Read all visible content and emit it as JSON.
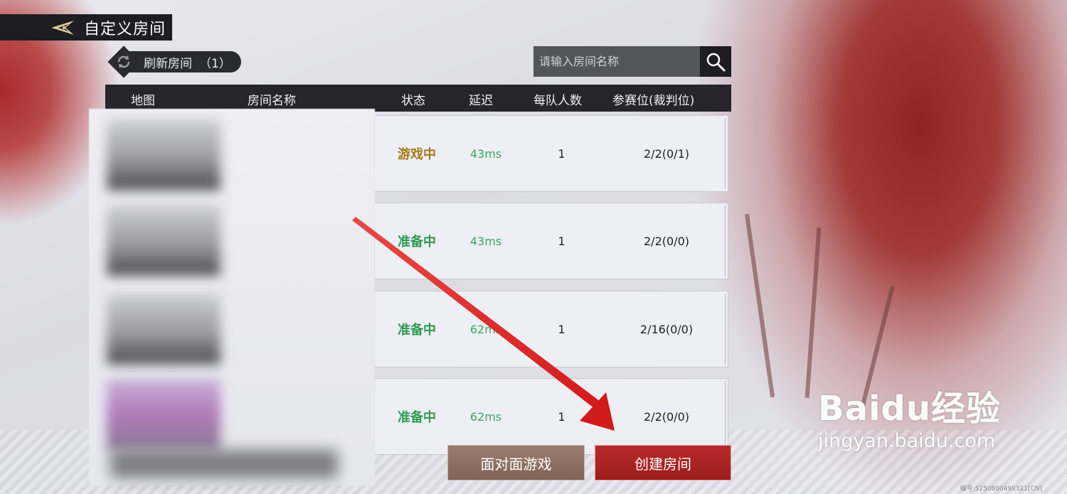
{
  "header": {
    "title": "自定义房间"
  },
  "refresh": {
    "label": "刷新房间",
    "count": "（1）"
  },
  "search": {
    "placeholder": "请输入房间名称"
  },
  "columns": {
    "map": "地图",
    "room_name": "房间名称",
    "status": "状态",
    "latency": "延迟",
    "per_team": "每队人数",
    "slots": "参赛位(裁判位)"
  },
  "rooms": [
    {
      "status": "游戏中",
      "status_color": "#a07b17",
      "latency": "43ms",
      "per_team": "1",
      "slots": "2/2(0/1)"
    },
    {
      "status": "准备中",
      "status_color": "#2e9a4f",
      "latency": "43ms",
      "per_team": "1",
      "slots": "2/2(0/0)"
    },
    {
      "status": "准备中",
      "status_color": "#2e9a4f",
      "latency": "62ms",
      "per_team": "1",
      "slots": "2/16(0/0)"
    },
    {
      "status": "准备中",
      "status_color": "#2e9a4f",
      "latency": "62ms",
      "per_team": "1",
      "slots": "2/2(0/0)"
    }
  ],
  "buttons": {
    "face_to_face": "面对面游戏",
    "create_room": "创建房间"
  },
  "watermark": {
    "logo": "Baidu经验",
    "url": "jingyan.baidu.com"
  },
  "footer": {
    "id": "编号:5250800490321[CN]"
  },
  "colors": {
    "accent_red": "#b82a2a",
    "latency_green": "#3da862",
    "dark_bar": "#25252b"
  }
}
